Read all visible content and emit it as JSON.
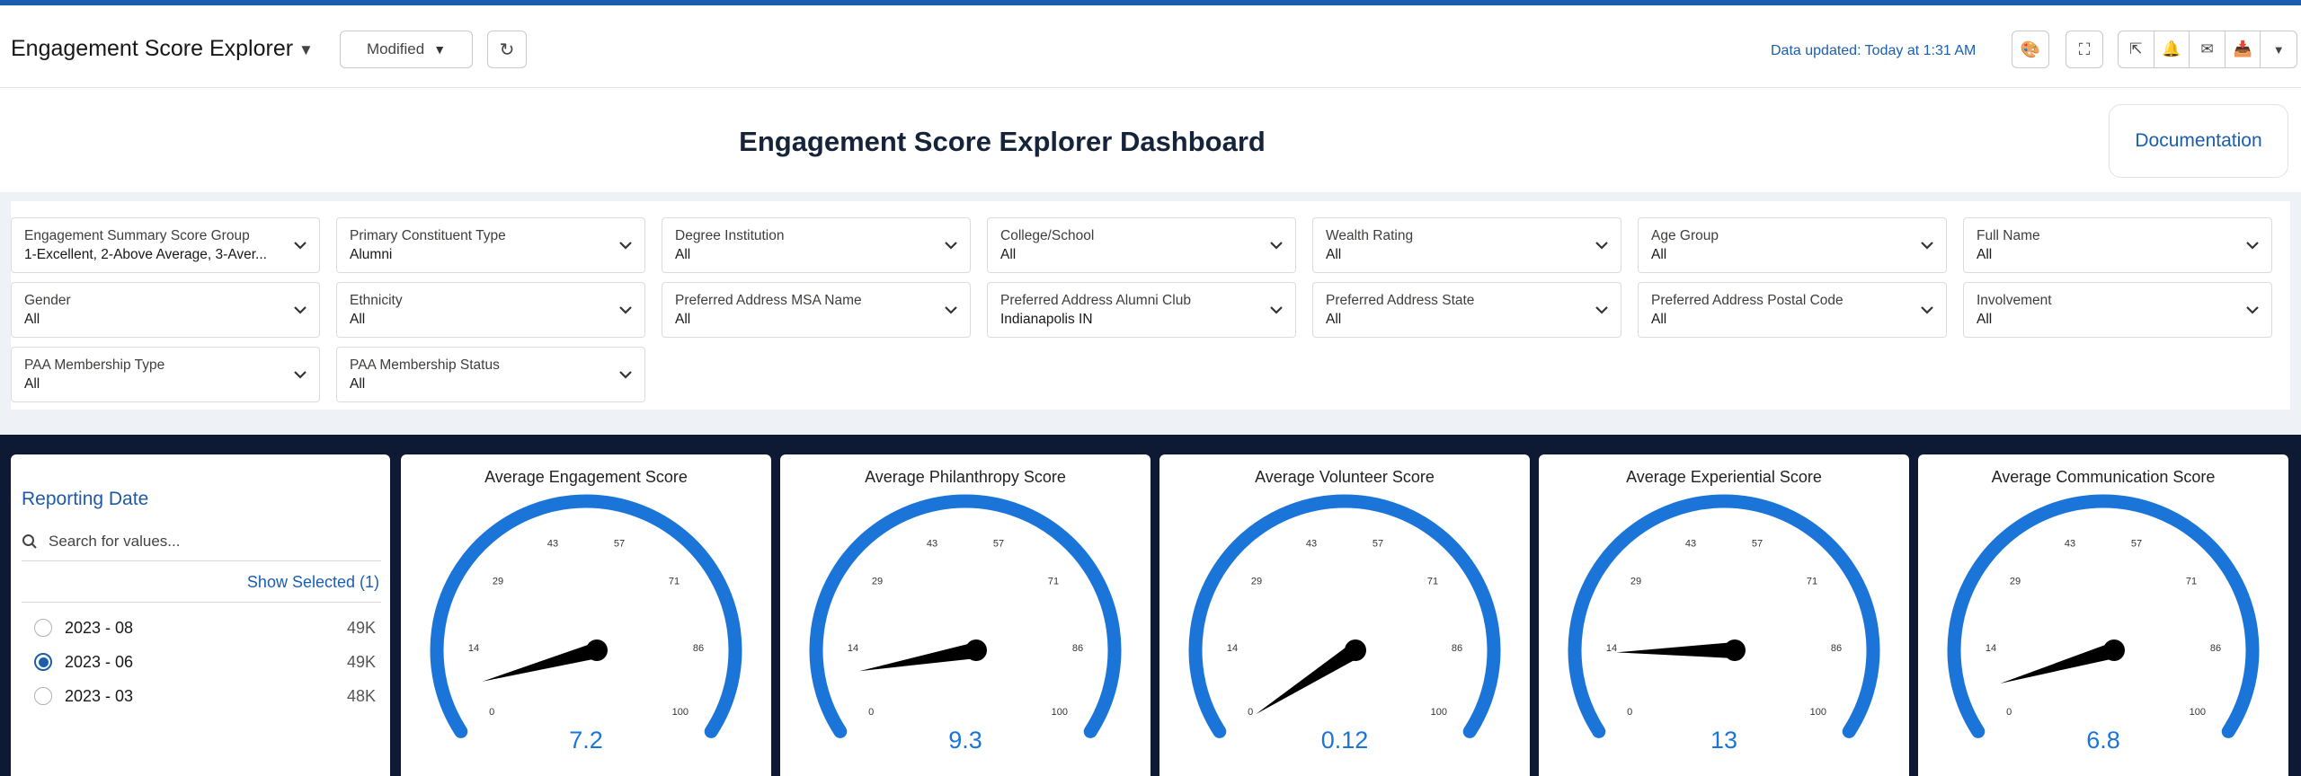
{
  "header": {
    "title": "Engagement Score Explorer",
    "modified_label": "Modified",
    "data_updated": "Data updated: Today at 1:31 AM"
  },
  "main_title": "Engagement Score Explorer Dashboard",
  "documentation_label": "Documentation",
  "filters": [
    {
      "label": "Engagement Summary Score Group",
      "value": "1-Excellent, 2-Above Average, 3-Aver..."
    },
    {
      "label": "Primary Constituent Type",
      "value": "Alumni"
    },
    {
      "label": "Degree Institution",
      "value": "All"
    },
    {
      "label": "College/School",
      "value": "All"
    },
    {
      "label": "Wealth Rating",
      "value": "All"
    },
    {
      "label": "Age Group",
      "value": "All"
    },
    {
      "label": "Full Name",
      "value": "All"
    },
    {
      "label": "Gender",
      "value": "All"
    },
    {
      "label": "Ethnicity",
      "value": "All"
    },
    {
      "label": "Preferred Address MSA Name",
      "value": "All"
    },
    {
      "label": "Preferred Address Alumni Club",
      "value": "Indianapolis IN"
    },
    {
      "label": "Preferred Address State",
      "value": "All"
    },
    {
      "label": "Preferred Address Postal Code",
      "value": "All"
    },
    {
      "label": "Involvement",
      "value": "All"
    },
    {
      "label": "PAA Membership Type",
      "value": "All"
    },
    {
      "label": "PAA Membership Status",
      "value": "All"
    }
  ],
  "reporting_date": {
    "title": "Reporting Date",
    "search_placeholder": "Search for values...",
    "show_selected": "Show Selected (1)",
    "options": [
      {
        "label": "2023 - 08",
        "count": "49K",
        "selected": false
      },
      {
        "label": "2023 - 06",
        "count": "49K",
        "selected": true
      },
      {
        "label": "2023 - 03",
        "count": "48K",
        "selected": false
      }
    ]
  },
  "gauge_scale": {
    "min": 0,
    "max": 100,
    "ticks": [
      "0",
      "14",
      "29",
      "43",
      "57",
      "71",
      "86",
      "100"
    ],
    "arc_color": "#1b75d9",
    "needle_color": "#000000",
    "value_color": "#1b75d9"
  },
  "gauges": [
    {
      "title": "Average Engagement Score",
      "value": 7.2,
      "display": "7.2"
    },
    {
      "title": "Average Philanthropy Score",
      "value": 9.3,
      "display": "9.3"
    },
    {
      "title": "Average Volunteer Score",
      "value": 0.12,
      "display": "0.12"
    },
    {
      "title": "Average Experiential Score",
      "value": 13,
      "display": "13"
    },
    {
      "title": "Average Communication Score",
      "value": 6.8,
      "display": "6.8"
    }
  ],
  "icons": {
    "title_caret": "caret-down-icon",
    "refresh": "refresh-icon",
    "theme": "palette-icon",
    "fullscreen": "expand-icon",
    "share": "share-icon",
    "bell": "bell-icon",
    "mail": "mail-icon",
    "save": "inbox-icon",
    "more": "caret-down-icon",
    "search": "search-icon",
    "filter_chevron": "chevron-down-icon"
  }
}
